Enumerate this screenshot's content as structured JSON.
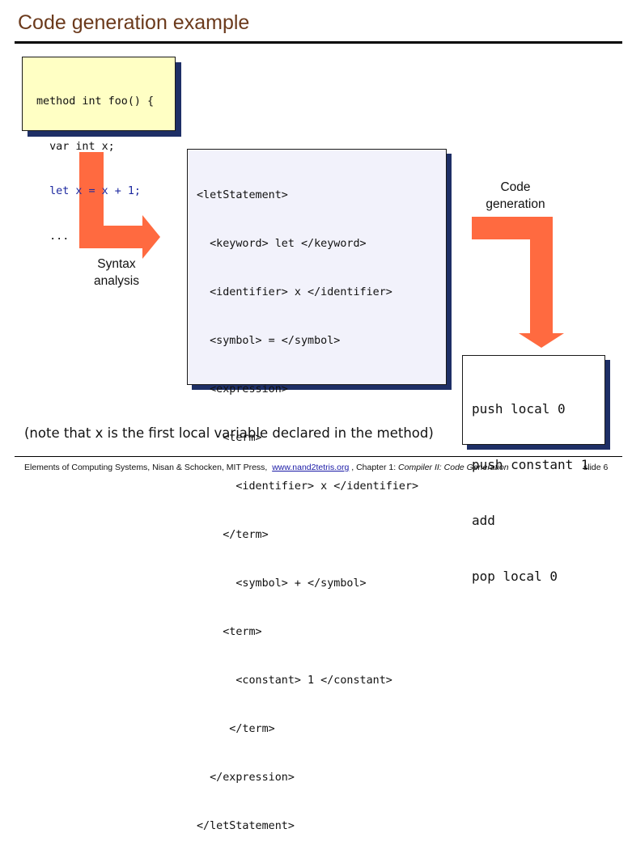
{
  "slide": {
    "title": "Code generation example",
    "note": "(note that x is the first local variable declared in the method)"
  },
  "source_code": {
    "line1": "method int foo() {",
    "line2": "  var int x;",
    "line3": "  let x = x + 1;",
    "line4": "  ..."
  },
  "parse_tree": {
    "lines": [
      "<letStatement>",
      "  <keyword> let </keyword>",
      "  <identifier> x </identifier>",
      "  <symbol> = </symbol>",
      "  <expression>",
      "    <term>",
      "      <identifier> x </identifier>",
      "    </term>",
      "      <symbol> + </symbol>",
      "    <term>",
      "      <constant> 1 </constant>",
      "     </term>",
      "  </expression>",
      "</letStatement>"
    ]
  },
  "vm_code": {
    "lines": [
      "push local 0",
      "push constant 1",
      "add",
      "pop local 0"
    ]
  },
  "labels": {
    "syntax_line1": "Syntax",
    "syntax_line2": "analysis",
    "codegen_line1": "Code",
    "codegen_line2": "generation"
  },
  "footer": {
    "text_before": "Elements of Computing Systems, Nisan & Schocken, MIT Press,",
    "link": "www.nand2tetris.org",
    "text_middle": ", Chapter 1:",
    "chapter_title": "Compiler II: Code Generation",
    "slide_number": "slide 6"
  },
  "colors": {
    "title": "#6b3a1c",
    "arrow": "#ff6a40",
    "source_box_fill": "#ffffc4",
    "shadow": "#1e2f66"
  }
}
